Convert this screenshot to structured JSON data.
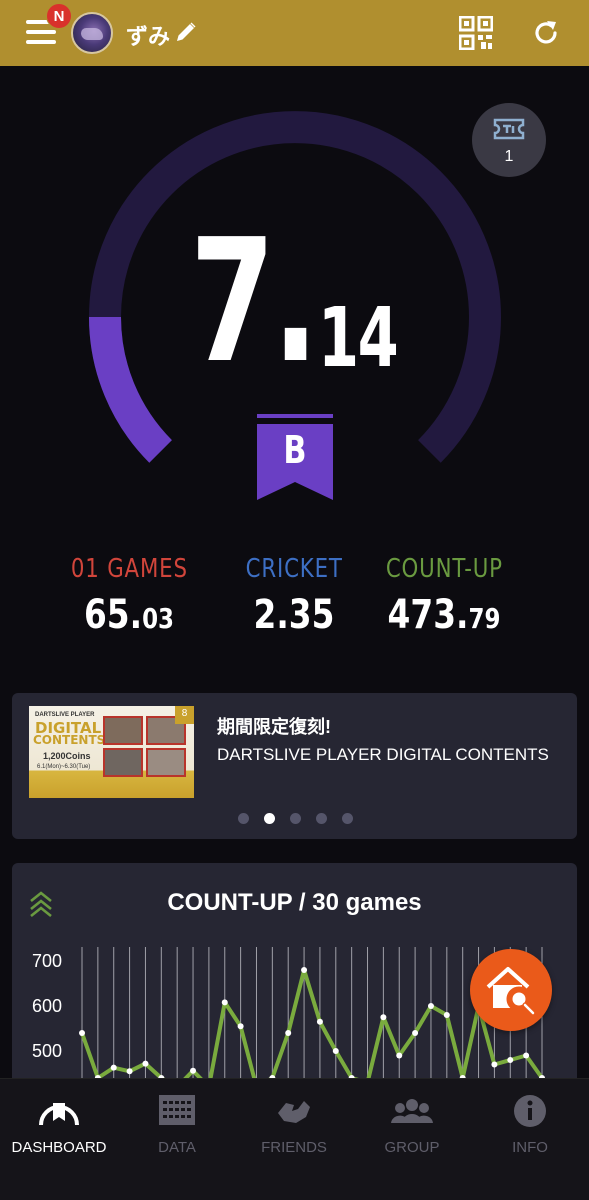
{
  "header": {
    "menu_badge": "N",
    "username": "ずみ"
  },
  "rating": {
    "integer": "7.",
    "decimal": "14",
    "flight_class": "B",
    "gauge_progress": 0.71
  },
  "ticket": {
    "count": "1"
  },
  "stats": [
    {
      "label": "01 GAMES",
      "value_main": "65.",
      "value_small": "03",
      "color": "#d1453b"
    },
    {
      "label": "CRICKET",
      "value_main": "2.35",
      "value_small": "",
      "color": "#3d6fc4"
    },
    {
      "label": "COUNT-UP",
      "value_main": "473.",
      "value_small": "79",
      "color": "#6a9a40"
    }
  ],
  "banner": {
    "title": "期間限定復刻!",
    "subtitle": "DARTSLIVE PLAYER DIGITAL CONTENTS",
    "image_text": {
      "line1": "DARTSLIVE PLAYER",
      "line2": "DIGITAL",
      "line3": "CONTENTS",
      "coins": "1,200Coins",
      "dates": "6.1(Mon)~6.30(Tue)",
      "corner": "8"
    },
    "dots_total": 5,
    "dots_active": 1
  },
  "chart": {
    "title": "COUNT-UP / 30 games"
  },
  "chart_data": {
    "type": "line",
    "title": "COUNT-UP / 30 games",
    "ytick_labels": [
      "700",
      "600",
      "500"
    ],
    "yticks": [
      700,
      600,
      500
    ],
    "ylim": [
      440,
      720
    ],
    "x": [
      1,
      2,
      3,
      4,
      5,
      6,
      7,
      8,
      9,
      10,
      11,
      12,
      13,
      14,
      15,
      16,
      17,
      18,
      19,
      20,
      21,
      22,
      23,
      24,
      25,
      26,
      27,
      28,
      29,
      30
    ],
    "series": [
      {
        "values": [
          540,
          440,
          463,
          455,
          472,
          440,
          420,
          456,
          420,
          608,
          555,
          420,
          440,
          540,
          680,
          565,
          500,
          440,
          430,
          575,
          490,
          540,
          600,
          580,
          440,
          600,
          470,
          480,
          490,
          440
        ]
      }
    ],
    "grid": true,
    "line_color": "#7aab3e"
  },
  "nav": {
    "items": [
      {
        "label": "DASHBOARD",
        "icon": "dashboard-icon",
        "active": true
      },
      {
        "label": "DATA",
        "icon": "data-icon",
        "active": false
      },
      {
        "label": "FRIENDS",
        "icon": "friends-icon",
        "active": false
      },
      {
        "label": "GROUP",
        "icon": "group-icon",
        "active": false
      },
      {
        "label": "INFO",
        "icon": "info-icon",
        "active": false
      }
    ]
  },
  "colors": {
    "header": "#b08f2f",
    "gauge_fill": "#6a3fc4",
    "gauge_track": "#22193f",
    "fab": "#ea5a1a"
  }
}
